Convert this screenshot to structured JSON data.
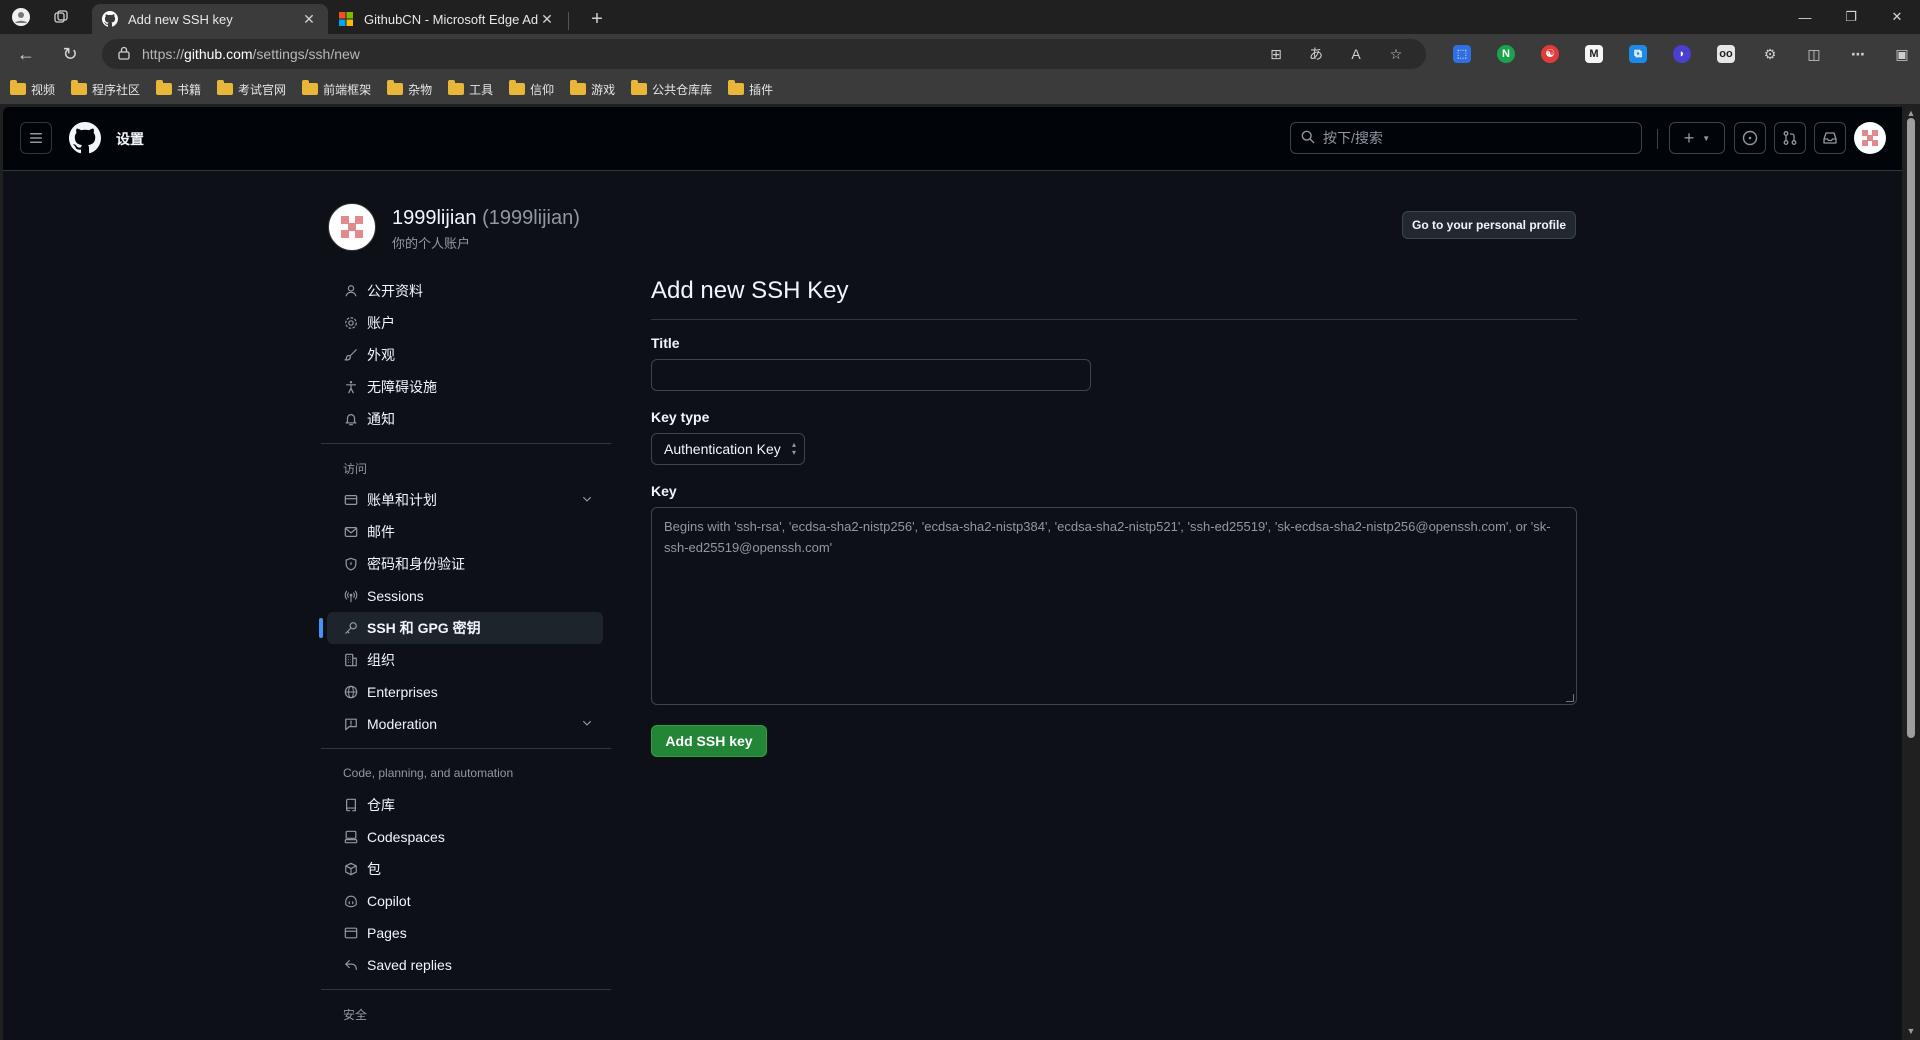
{
  "browser": {
    "tabs": [
      {
        "title": "Add new SSH key",
        "active": true,
        "favicon": "github-icon"
      },
      {
        "title": "GithubCN - Microsoft Edge Addo",
        "active": false,
        "favicon": "microsoft-icon"
      }
    ],
    "url_prefix": "https://",
    "url_domain": "github.com",
    "url_path": "/settings/ssh/new",
    "bookmarks": [
      "视频",
      "程序社区",
      "书籍",
      "考试官网",
      "前端框架",
      "杂物",
      "工具",
      "信仰",
      "游戏",
      "公共仓库库",
      "插件"
    ]
  },
  "header": {
    "title": "设置",
    "search_placeholder": "按下/搜索"
  },
  "user": {
    "display_name": "1999lijian",
    "login": "(1999lijian)",
    "subtitle": "你的个人账户",
    "profile_button": "Go to your personal profile"
  },
  "sidenav": {
    "group1": [
      {
        "label": "公开资料",
        "icon": "person-icon"
      },
      {
        "label": "账户",
        "icon": "gear-icon"
      },
      {
        "label": "外观",
        "icon": "paintbrush-icon"
      },
      {
        "label": "无障碍设施",
        "icon": "accessibility-icon"
      },
      {
        "label": "通知",
        "icon": "bell-icon"
      }
    ],
    "access_heading": "访问",
    "group2": [
      {
        "label": "账单和计划",
        "icon": "credit-card-icon"
      },
      {
        "label": "邮件",
        "icon": "mail-icon"
      },
      {
        "label": "密码和身份验证",
        "icon": "shield-icon"
      },
      {
        "label": "Sessions",
        "icon": "broadcast-icon"
      },
      {
        "label": "SSH 和 GPG 密钥",
        "icon": "key-icon"
      },
      {
        "label": "组织",
        "icon": "organization-icon"
      },
      {
        "label": "Enterprises",
        "icon": "globe-icon"
      },
      {
        "label": "Moderation",
        "icon": "report-icon"
      }
    ],
    "code_heading": "Code, planning, and automation",
    "group3": [
      {
        "label": "仓库",
        "icon": "repo-icon"
      },
      {
        "label": "Codespaces",
        "icon": "codespaces-icon"
      },
      {
        "label": "包",
        "icon": "package-icon"
      },
      {
        "label": "Copilot",
        "icon": "copilot-icon"
      },
      {
        "label": "Pages",
        "icon": "browser-icon"
      },
      {
        "label": "Saved replies",
        "icon": "reply-icon"
      }
    ],
    "security_heading": "安全"
  },
  "form": {
    "heading": "Add new SSH Key",
    "title_label": "Title",
    "title_value": "",
    "key_type_label": "Key type",
    "key_type_value": "Authentication Key",
    "key_label": "Key",
    "key_placeholder": "Begins with 'ssh-rsa', 'ecdsa-sha2-nistp256', 'ecdsa-sha2-nistp384', 'ecdsa-sha2-nistp521', 'ssh-ed25519', 'sk-ecdsa-sha2-nistp256@openssh.com', or 'sk-ssh-ed25519@openssh.com'",
    "submit_label": "Add SSH key"
  },
  "colors": {
    "page_bg": "#0d1117",
    "header_bg": "#010409",
    "accent_blue": "#4493f8",
    "primary_green": "#238636",
    "avatar_pink": "#e1898d"
  }
}
